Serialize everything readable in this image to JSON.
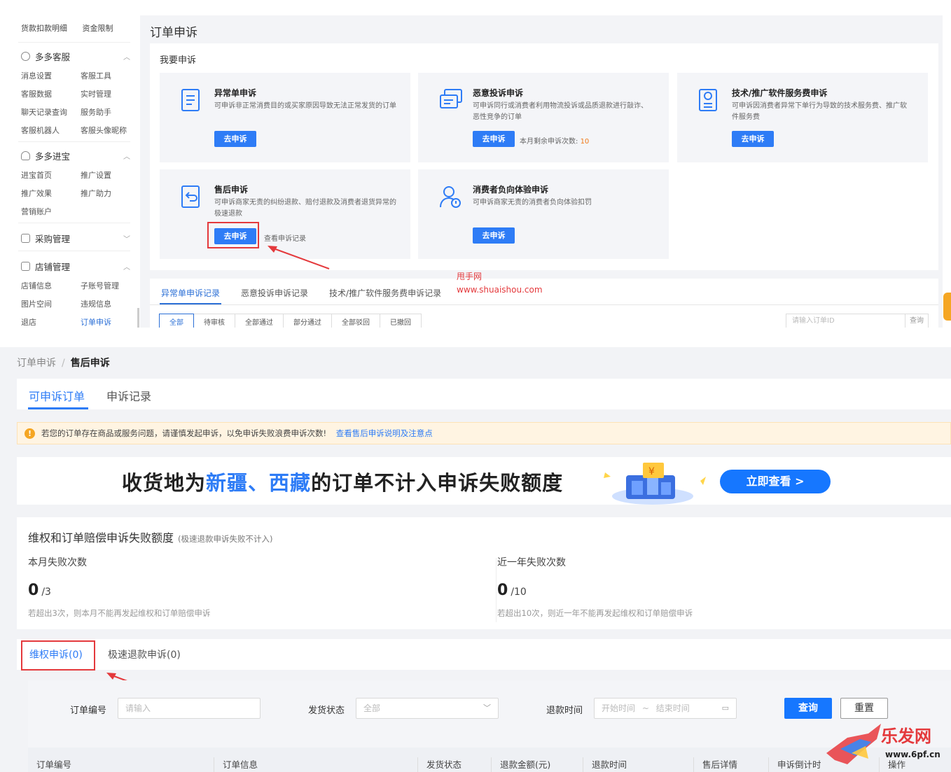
{
  "top": {
    "sidebar": {
      "top_links": [
        "货款扣款明细",
        "资金限制"
      ],
      "groups": [
        {
          "title": "多多客服",
          "items": [
            "消息设置",
            "客服工具",
            "客服数据",
            "实时管理",
            "聊天记录查询",
            "服务助手",
            "客服机器人",
            "客服头像昵称"
          ]
        },
        {
          "title": "多多进宝",
          "items": [
            "进宝首页",
            "推广设置",
            "推广效果",
            "推广助力",
            "营销账户"
          ]
        },
        {
          "title": "采购管理",
          "items": []
        },
        {
          "title": "店铺管理",
          "items": [
            "店铺信息",
            "子账号管理",
            "图片空间",
            "违规信息",
            "退店",
            "订单申诉"
          ]
        }
      ],
      "active_item": "订单申诉"
    },
    "page_title": "订单申诉",
    "panel_title": "我要申诉",
    "cards": [
      {
        "title": "异常单申诉",
        "desc": "可申诉非正常消费目的或买家原因导致无法正常发货的订单",
        "button": "去申诉"
      },
      {
        "title": "恶意投诉申诉",
        "desc": "可申诉同行或消费者利用物流投诉或品质退款进行敲诈、恶性竞争的订单",
        "button": "去申诉",
        "extra_label": "本月剩余申诉次数:",
        "extra_value": "10"
      },
      {
        "title": "技术/推广软件服务费申诉",
        "desc": "可申诉因消费者异常下单行为导致的技术服务费、推广软件服务费",
        "button": "去申诉"
      },
      {
        "title": "售后申诉",
        "desc": "可申诉商家无责的纠纷退款、赔付退款及消费者退货异常的极速退款",
        "button": "去申诉",
        "link": "查看申诉记录"
      },
      {
        "title": "消费者负向体验申诉",
        "desc": "可申诉商家无责的消费者负向体验扣罚",
        "button": "去申诉"
      }
    ],
    "watermark": [
      "甩手网",
      "www.shuaishou.com"
    ],
    "record_tabs": [
      "异常单申诉记录",
      "恶意投诉申诉记录",
      "技术/推广软件服务费申诉记录"
    ],
    "status_filters": [
      "全部",
      "待审核",
      "全部通过",
      "部分通过",
      "全部驳回",
      "已撤回"
    ],
    "order_search": {
      "placeholder": "请输入订单ID",
      "button": "查询"
    }
  },
  "bottom": {
    "breadcrumb": [
      "订单申诉",
      "/",
      "售后申诉"
    ],
    "tabs": [
      "可申诉订单",
      "申诉记录"
    ],
    "notice": {
      "icon": "!",
      "text": "若您的订单存在商品或服务问题，请谨慎发起申诉，以免申诉失败浪费申诉次数!",
      "link": "查看售后申诉说明及注意点"
    },
    "banner": {
      "pre": "收货地为",
      "hl1": "新疆",
      "sep": "、",
      "hl2": "西藏",
      "post": "的订单不计入申诉失败额度",
      "cta": "立即查看 >"
    },
    "quota": {
      "title": "维权和订单赔偿申诉失败额度",
      "subtitle": "(极速退款申诉失败不计入)",
      "month": {
        "label": "本月失败次数",
        "value": "0",
        "limit": "/3",
        "hint": "若超出3次，则本月不能再发起维权和订单赔偿申诉"
      },
      "year": {
        "label": "近一年失败次数",
        "value": "0",
        "limit": "/10",
        "hint": "若超出10次，则近一年不能再发起维权和订单赔偿申诉"
      }
    },
    "sub_tabs": [
      "维权申诉(0)",
      "极速退款申诉(0)"
    ],
    "filters": {
      "order_no": {
        "label": "订单编号",
        "placeholder": "请输入"
      },
      "ship_status": {
        "label": "发货状态",
        "value": "全部"
      },
      "refund_time": {
        "label": "退款时间",
        "start": "开始时间",
        "sep": "~",
        "end": "结束时间"
      },
      "query": "查询",
      "reset": "重置"
    },
    "table_headers": [
      "订单编号",
      "订单信息",
      "发货状态",
      "退款金额(元)",
      "退款时间",
      "售后详情",
      "申诉倒计时",
      "操作"
    ],
    "logo_text": "乐发网",
    "logo_url": "www.6pf.cn"
  },
  "colors": {
    "primary": "#2e7cf6",
    "highlight_box": "#e4393c",
    "warning": "#f5a623"
  }
}
